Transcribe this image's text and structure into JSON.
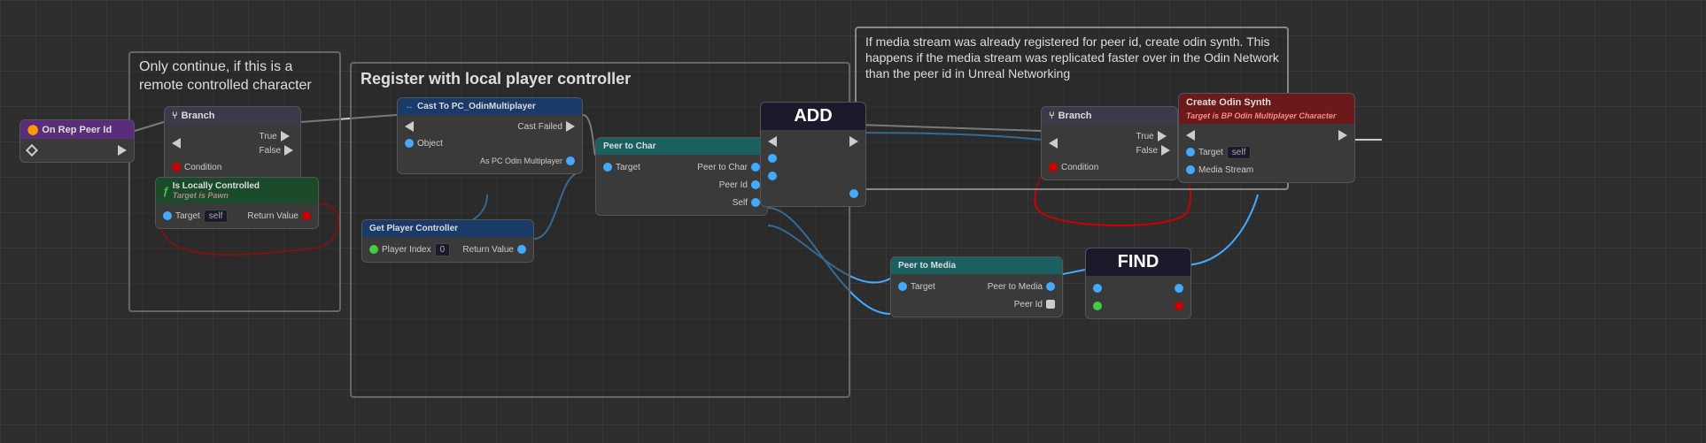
{
  "nodes": {
    "on_rep_peer_id": {
      "title": "On Rep Peer Id",
      "header_class": "header-purple"
    },
    "branch1": {
      "title": "Branch",
      "icon": "⑂",
      "true_label": "True",
      "false_label": "False",
      "condition_label": "Condition",
      "header_class": "header-gray"
    },
    "is_locally_controlled": {
      "title": "Is Locally Controlled",
      "subtitle": "Target is Pawn",
      "target_label": "Target",
      "target_value": "self",
      "return_label": "Return Value",
      "header_class": "header-green-dark"
    },
    "cast_to_pc": {
      "title": "Cast To PC_OdinMultiplayer",
      "object_label": "Object",
      "cast_failed_label": "Cast Failed",
      "as_pc_label": "As PC Odin Multiplayer",
      "header_class": "header-blue"
    },
    "get_player_controller": {
      "title": "Get Player Controller",
      "player_index_label": "Player Index",
      "player_index_value": "0",
      "return_label": "Return Value",
      "header_class": "header-blue"
    },
    "peer_to_char": {
      "title": "Peer to Char",
      "target_label": "Target",
      "peer_to_char_label": "Peer to Char",
      "peer_id_label": "Peer Id",
      "self_label": "Self",
      "header_class": "header-teal"
    },
    "add_node": {
      "title": "ADD",
      "header_class": "header-dark"
    },
    "branch2": {
      "title": "Branch",
      "icon": "⑂",
      "true_label": "True",
      "false_label": "False",
      "condition_label": "Condition",
      "header_class": "header-gray"
    },
    "create_odin_synth": {
      "title": "Create Odin Synth",
      "subtitle": "Target is BP Odin Multiplayer Character",
      "target_label": "Target",
      "target_value": "self",
      "media_stream_label": "Media Stream",
      "header_class": "header-red"
    },
    "peer_to_media": {
      "title": "Peer to Media",
      "target_label": "Target",
      "peer_to_media_label": "Peer to Media",
      "peer_id_label": "Peer Id",
      "header_class": "header-teal"
    },
    "find_node": {
      "title": "FIND",
      "header_class": "header-dark"
    }
  },
  "comments": {
    "comment1": {
      "text": "Only continue, if this is a\nremote controlled character"
    },
    "comment2": {
      "text": "Register with local player controller"
    },
    "comment3": {
      "text": "If media stream was already registered for peer id, create odin synth.\nThis happens if the media stream was replicated faster over in the Odin\nNetwork than the peer id in Unreal Networking"
    }
  },
  "colors": {
    "exec_wire": "#ffffff",
    "bool_wire": "#cc0000",
    "blue_wire": "#44aaff",
    "green_wire": "#44cc44",
    "background": "#2d2d2d"
  }
}
